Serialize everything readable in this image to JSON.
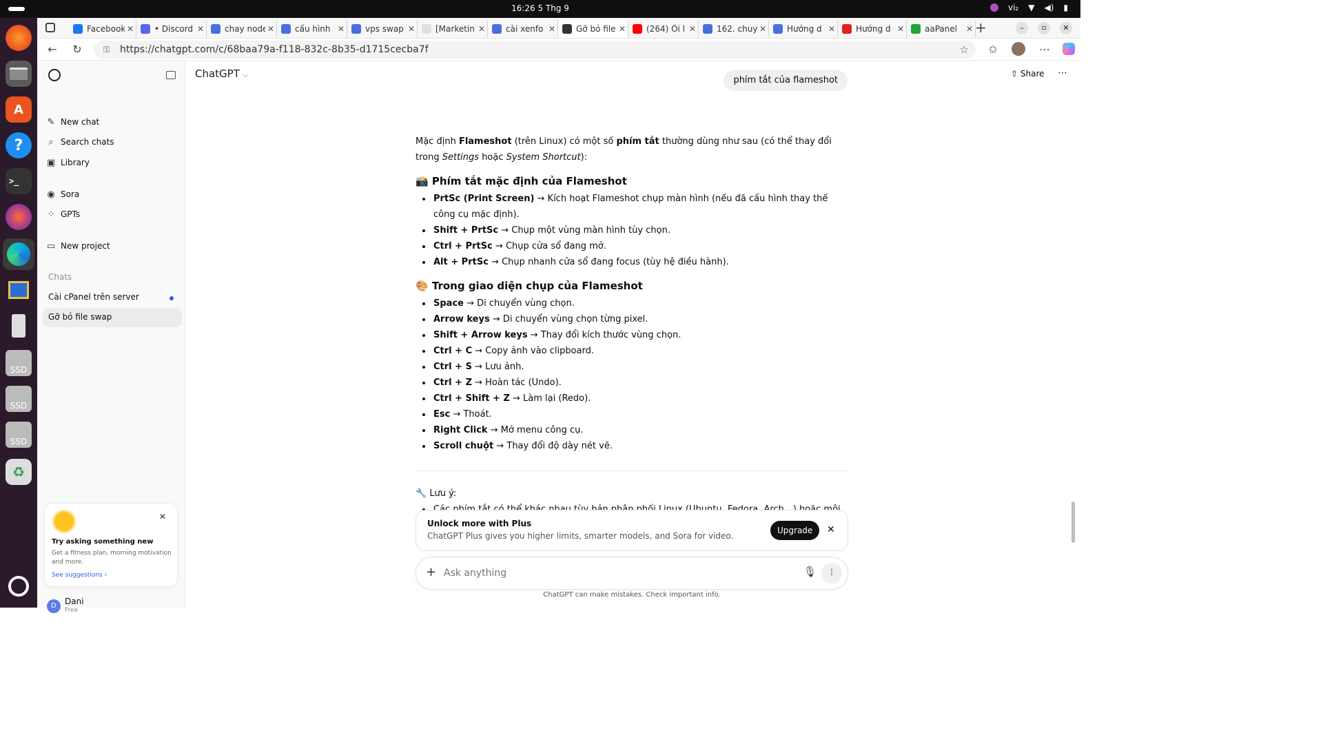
{
  "system": {
    "clock": "16:26  5 Thg 9",
    "input_method": "vi₂"
  },
  "dock": {
    "icons": [
      "firefox-icon",
      "files-icon",
      "app-center-icon",
      "help-icon",
      "terminal-icon",
      "firefox-dev-icon",
      "edge-icon",
      "remote-desktop-icon",
      "usb-drive-icon",
      "ssd-icon",
      "ssd-icon",
      "ssd-icon",
      "trash-icon",
      "ubuntu-icon"
    ],
    "ssd_label": "SSD"
  },
  "browser": {
    "tabs": [
      {
        "label": "Facebook",
        "color": "#1877f2"
      },
      {
        "label": "• Discord",
        "color": "#5865f2"
      },
      {
        "label": "chay node",
        "color": "#4a6ee0"
      },
      {
        "label": "cấu hình",
        "color": "#4a6ee0"
      },
      {
        "label": "vps swap",
        "color": "#4a6ee0"
      },
      {
        "label": "[Marketin",
        "color": "#e0e0e0"
      },
      {
        "label": "cài xenfo",
        "color": "#4a6ee0"
      },
      {
        "label": "Gỡ bỏ file",
        "color": "#333333"
      },
      {
        "label": "(264) Ôi l",
        "color": "#ff0000"
      },
      {
        "label": "162. chuy",
        "color": "#4a6ee0"
      },
      {
        "label": "Hướng d",
        "color": "#4a6ee0"
      },
      {
        "label": "Hướng d",
        "color": "#e02020"
      },
      {
        "label": "aaPanel",
        "color": "#20a53a"
      }
    ],
    "url": "https://chatgpt.com/c/68baa79a-f118-832c-8b35-d1715cecba7f"
  },
  "sidebar": {
    "new_chat": "New chat",
    "search_chats": "Search chats",
    "library": "Library",
    "sora": "Sora",
    "gpts": "GPTs",
    "new_project": "New project",
    "chats_header": "Chats",
    "chats": [
      "Cài cPanel trên server",
      "Gỡ bỏ file swap"
    ],
    "suggest": {
      "title": "Try asking something new",
      "body": "Get a fitness plan, morning motivation and more.",
      "link": "See suggestions"
    },
    "user": {
      "initial": "D",
      "name": "Dani",
      "plan": "Free"
    }
  },
  "header": {
    "model": "ChatGPT",
    "share": "Share"
  },
  "conversation": {
    "user_message": "phím tắt của flameshot",
    "intro": {
      "t1": "Mặc định ",
      "b1": "Flameshot",
      "t2": " (trên Linux) có một số ",
      "b2": "phím tắt",
      "t3": " thường dùng như sau (có thể thay đổi trong ",
      "i1": "Settings",
      "t4": " hoặc ",
      "i2": "System Shortcut",
      "t5": "):"
    },
    "section1_title": "📸 Phím tắt mặc định của Flameshot",
    "section1": [
      {
        "key": "PrtSc (Print Screen)",
        "desc": " → Kích hoạt Flameshot chụp màn hình (nếu đã cấu hình thay thế công cụ mặc định)."
      },
      {
        "key": "Shift + PrtSc",
        "desc": " → Chụp một vùng màn hình tùy chọn."
      },
      {
        "key": "Ctrl + PrtSc",
        "desc": " → Chụp cửa sổ đang mở."
      },
      {
        "key": "Alt + PrtSc",
        "desc": " → Chụp nhanh cửa sổ đang focus (tùy hệ điều hành)."
      }
    ],
    "section2_title": "🎨 Trong giao diện chụp của Flameshot",
    "section2": [
      {
        "key": "Space",
        "desc": " → Di chuyển vùng chọn."
      },
      {
        "key": "Arrow keys",
        "desc": " → Di chuyển vùng chọn từng pixel."
      },
      {
        "key": "Shift + Arrow keys",
        "desc": " → Thay đổi kích thước vùng chọn."
      },
      {
        "key": "Ctrl + C",
        "desc": " → Copy ảnh vào clipboard."
      },
      {
        "key": "Ctrl + S",
        "desc": " → Lưu ảnh."
      },
      {
        "key": "Ctrl + Z",
        "desc": " → Hoàn tác (Undo)."
      },
      {
        "key": "Ctrl + Shift + Z",
        "desc": " → Làm lại (Redo)."
      },
      {
        "key": "Esc",
        "desc": " → Thoát."
      },
      {
        "key": "Right Click",
        "desc": " → Mở menu công cụ."
      },
      {
        "key": "Scroll chuột",
        "desc": " → Thay đổi độ dày nét vẽ."
      }
    ],
    "note_title": "🔧 Lưu ý:",
    "note_item": "Các phím tắt có thể khác nhau tùy bản phân phối Linux (Ubuntu, Fedora, Arch…) hoặc môi trường desktop (GNOME, KDE…)."
  },
  "upsell": {
    "title": "Unlock more with Plus",
    "body": "ChatGPT Plus gives you higher limits, smarter models, and Sora for video.",
    "button": "Upgrade"
  },
  "composer": {
    "placeholder": "Ask anything",
    "disclaimer": "ChatGPT can make mistakes. Check important info."
  }
}
